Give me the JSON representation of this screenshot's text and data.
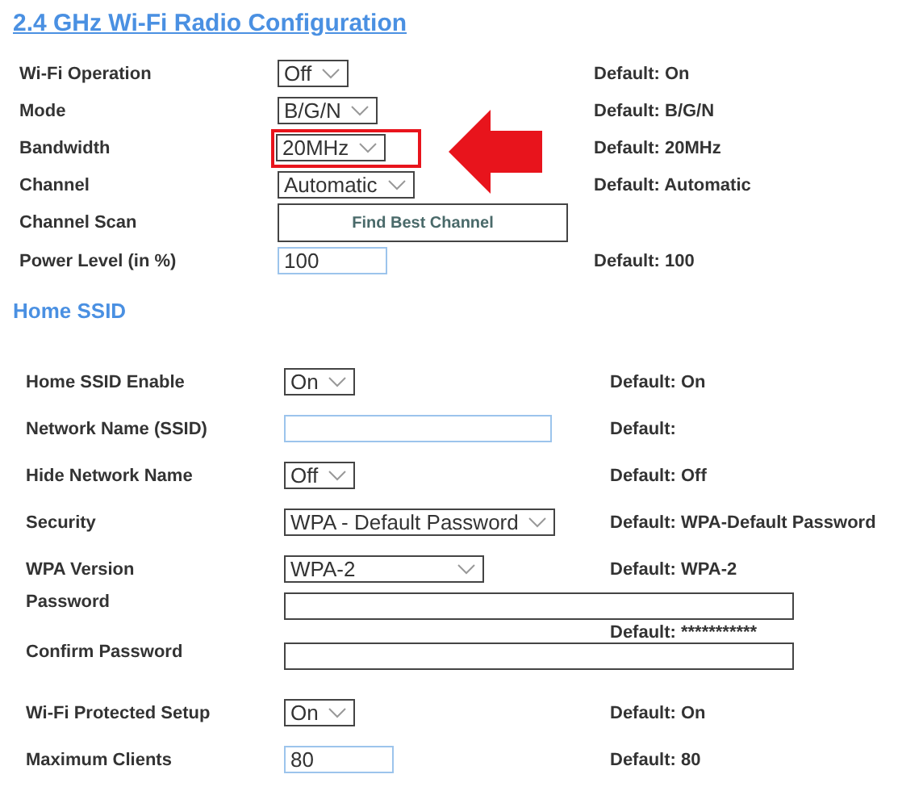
{
  "sections": [
    {
      "title": "2.4 GHz Wi-Fi Radio Configuration",
      "rows": [
        {
          "label": "Wi-Fi Operation",
          "control": {
            "kind": "select",
            "value": "Off"
          },
          "default": "Default: On",
          "highlighted": false
        },
        {
          "label": "Mode",
          "control": {
            "kind": "select",
            "value": "B/G/N"
          },
          "default": "Default: B/G/N",
          "highlighted": false
        },
        {
          "label": "Bandwidth",
          "control": {
            "kind": "select",
            "value": "20MHz"
          },
          "default": "Default: 20MHz",
          "highlighted": true
        },
        {
          "label": "Channel",
          "control": {
            "kind": "select",
            "value": "Automatic"
          },
          "default": "Default: Automatic",
          "highlighted": false
        },
        {
          "label": "Channel Scan",
          "control": {
            "kind": "button",
            "value": "Find Best Channel"
          },
          "highlighted": false
        },
        {
          "label": "Power Level (in %)",
          "control": {
            "kind": "number",
            "value": "100"
          },
          "default": "Default: 100",
          "highlighted": false
        }
      ]
    },
    {
      "title": "Home SSID",
      "rows": [
        {
          "label": "Home SSID Enable",
          "control": {
            "kind": "select",
            "value": "On"
          },
          "default": "Default: On",
          "highlighted": false
        },
        {
          "label": "Network Name (SSID)",
          "control": {
            "kind": "text"
          },
          "default": "Default:",
          "highlighted": false
        },
        {
          "label": "Hide Network Name",
          "control": {
            "kind": "select",
            "value": "Off"
          },
          "default": "Default: Off",
          "highlighted": false
        },
        {
          "label": "Security",
          "control": {
            "kind": "select",
            "value": "WPA - Default Password"
          },
          "default": "Default: WPA-Default Password",
          "highlighted": false
        },
        {
          "label": "WPA Version",
          "control": {
            "kind": "wideselect",
            "value": "WPA-2"
          },
          "default": "Default: WPA-2",
          "highlighted": false
        },
        {
          "label": "Password",
          "control": {
            "kind": "password"
          },
          "default": "Default: ***********",
          "highlighted": false
        },
        {
          "label": "Confirm Password",
          "control": {
            "kind": "password"
          },
          "highlighted": false
        },
        {
          "label": "Wi-Fi Protected Setup",
          "control": {
            "kind": "select",
            "value": "On"
          },
          "default": "Default: On",
          "highlighted": false
        },
        {
          "label": "Maximum Clients",
          "control": {
            "kind": "number",
            "value": "80"
          },
          "default": "Default: 80",
          "highlighted": false
        }
      ]
    }
  ]
}
